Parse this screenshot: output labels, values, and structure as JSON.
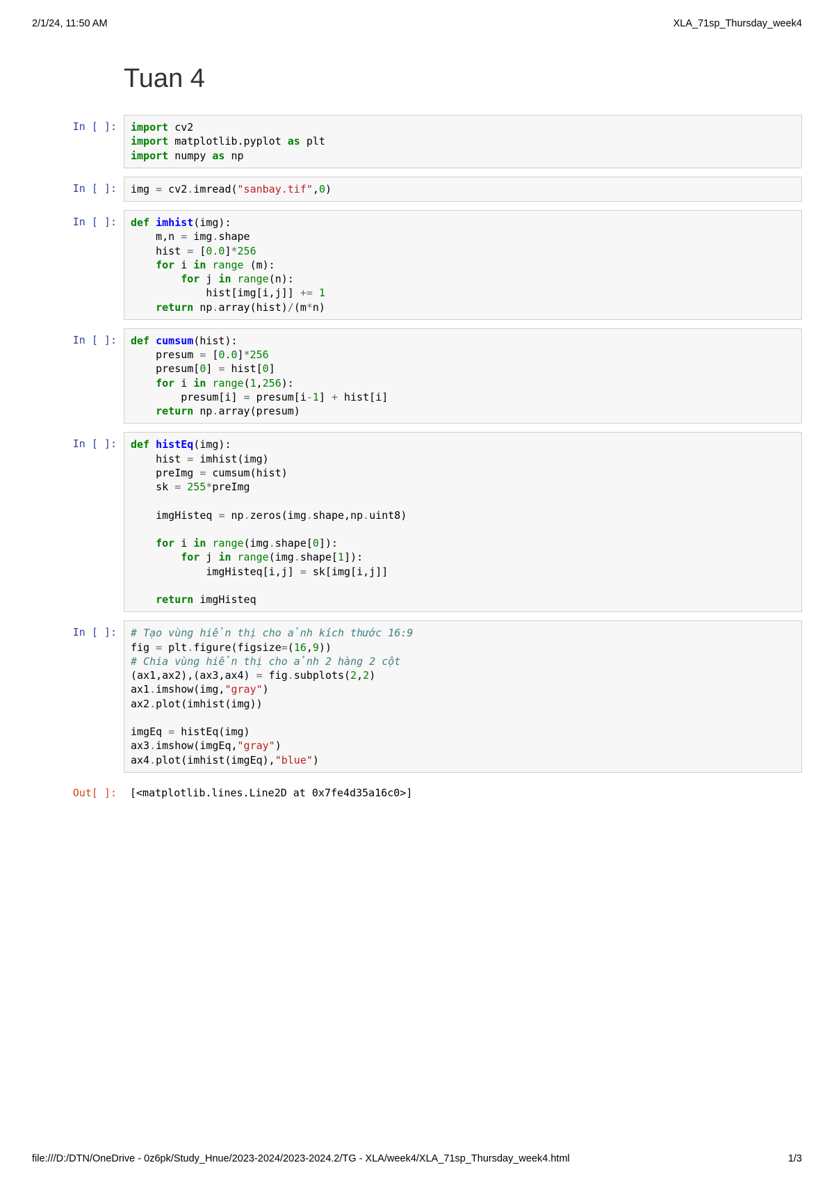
{
  "header": {
    "left": "2/1/24, 11:50 AM",
    "right": "XLA_71sp_Thursday_week4"
  },
  "footer": {
    "left": "file:///D:/DTN/OneDrive - 0z6pk/Study_Hnue/2023-2024/2023-2024.2/TG - XLA/week4/XLA_71sp_Thursday_week4.html",
    "right": "1/3"
  },
  "title": "Tuan 4",
  "prompts": {
    "in": "In [ ]:",
    "out": "Out[ ]:"
  },
  "cells": [
    {
      "type": "code",
      "tokens": [
        [
          {
            "c": "kw",
            "t": "import"
          },
          {
            "t": " cv2"
          }
        ],
        [
          {
            "c": "kw",
            "t": "import"
          },
          {
            "t": " matplotlib.pyplot "
          },
          {
            "c": "kw",
            "t": "as"
          },
          {
            "t": " plt"
          }
        ],
        [
          {
            "c": "kw",
            "t": "import"
          },
          {
            "t": " numpy "
          },
          {
            "c": "kw",
            "t": "as"
          },
          {
            "t": " np"
          }
        ]
      ]
    },
    {
      "type": "code",
      "tokens": [
        [
          {
            "t": "img "
          },
          {
            "c": "op",
            "t": "="
          },
          {
            "t": " cv2"
          },
          {
            "c": "op",
            "t": "."
          },
          {
            "t": "imread("
          },
          {
            "c": "str",
            "t": "\"sanbay.tif\""
          },
          {
            "t": ","
          },
          {
            "c": "num",
            "t": "0"
          },
          {
            "t": ")"
          }
        ]
      ]
    },
    {
      "type": "code",
      "tokens": [
        [
          {
            "c": "kw",
            "t": "def"
          },
          {
            "t": " "
          },
          {
            "c": "nn",
            "t": "imhist"
          },
          {
            "t": "(img):"
          }
        ],
        [
          {
            "t": "    m,n "
          },
          {
            "c": "op",
            "t": "="
          },
          {
            "t": " img"
          },
          {
            "c": "op",
            "t": "."
          },
          {
            "t": "shape"
          }
        ],
        [
          {
            "t": "    hist "
          },
          {
            "c": "op",
            "t": "="
          },
          {
            "t": " ["
          },
          {
            "c": "num",
            "t": "0.0"
          },
          {
            "t": "]"
          },
          {
            "c": "op",
            "t": "*"
          },
          {
            "c": "num",
            "t": "256"
          }
        ],
        [
          {
            "t": "    "
          },
          {
            "c": "kw",
            "t": "for"
          },
          {
            "t": " i "
          },
          {
            "c": "kw",
            "t": "in"
          },
          {
            "t": " "
          },
          {
            "c": "bi",
            "t": "range"
          },
          {
            "t": " (m):"
          }
        ],
        [
          {
            "t": "        "
          },
          {
            "c": "kw",
            "t": "for"
          },
          {
            "t": " j "
          },
          {
            "c": "kw",
            "t": "in"
          },
          {
            "t": " "
          },
          {
            "c": "bi",
            "t": "range"
          },
          {
            "t": "(n):"
          }
        ],
        [
          {
            "t": "            hist[img[i,j]] "
          },
          {
            "c": "op",
            "t": "+="
          },
          {
            "t": " "
          },
          {
            "c": "num",
            "t": "1"
          }
        ],
        [
          {
            "t": "    "
          },
          {
            "c": "kw",
            "t": "return"
          },
          {
            "t": " np"
          },
          {
            "c": "op",
            "t": "."
          },
          {
            "t": "array(hist)"
          },
          {
            "c": "op",
            "t": "/"
          },
          {
            "t": "(m"
          },
          {
            "c": "op",
            "t": "*"
          },
          {
            "t": "n)"
          }
        ]
      ]
    },
    {
      "type": "code",
      "tokens": [
        [
          {
            "c": "kw",
            "t": "def"
          },
          {
            "t": " "
          },
          {
            "c": "nn",
            "t": "cumsum"
          },
          {
            "t": "(hist):"
          }
        ],
        [
          {
            "t": "    presum "
          },
          {
            "c": "op",
            "t": "="
          },
          {
            "t": " ["
          },
          {
            "c": "num",
            "t": "0.0"
          },
          {
            "t": "]"
          },
          {
            "c": "op",
            "t": "*"
          },
          {
            "c": "num",
            "t": "256"
          }
        ],
        [
          {
            "t": "    presum["
          },
          {
            "c": "num",
            "t": "0"
          },
          {
            "t": "] "
          },
          {
            "c": "op",
            "t": "="
          },
          {
            "t": " hist["
          },
          {
            "c": "num",
            "t": "0"
          },
          {
            "t": "]"
          }
        ],
        [
          {
            "t": "    "
          },
          {
            "c": "kw",
            "t": "for"
          },
          {
            "t": " i "
          },
          {
            "c": "kw",
            "t": "in"
          },
          {
            "t": " "
          },
          {
            "c": "bi",
            "t": "range"
          },
          {
            "t": "("
          },
          {
            "c": "num",
            "t": "1"
          },
          {
            "t": ","
          },
          {
            "c": "num",
            "t": "256"
          },
          {
            "t": "):"
          }
        ],
        [
          {
            "t": "        presum[i] "
          },
          {
            "c": "op",
            "t": "="
          },
          {
            "t": " presum[i"
          },
          {
            "c": "op",
            "t": "-"
          },
          {
            "c": "num",
            "t": "1"
          },
          {
            "t": "] "
          },
          {
            "c": "op",
            "t": "+"
          },
          {
            "t": " hist[i]"
          }
        ],
        [
          {
            "t": "    "
          },
          {
            "c": "kw",
            "t": "return"
          },
          {
            "t": " np"
          },
          {
            "c": "op",
            "t": "."
          },
          {
            "t": "array(presum)"
          }
        ]
      ]
    },
    {
      "type": "code",
      "tokens": [
        [
          {
            "c": "kw",
            "t": "def"
          },
          {
            "t": " "
          },
          {
            "c": "nn",
            "t": "histEq"
          },
          {
            "t": "(img):"
          }
        ],
        [
          {
            "t": "    hist "
          },
          {
            "c": "op",
            "t": "="
          },
          {
            "t": " imhist(img)"
          }
        ],
        [
          {
            "t": "    preImg "
          },
          {
            "c": "op",
            "t": "="
          },
          {
            "t": " cumsum(hist)"
          }
        ],
        [
          {
            "t": "    sk "
          },
          {
            "c": "op",
            "t": "="
          },
          {
            "t": " "
          },
          {
            "c": "num",
            "t": "255"
          },
          {
            "c": "op",
            "t": "*"
          },
          {
            "t": "preImg"
          }
        ],
        [
          {
            "t": ""
          }
        ],
        [
          {
            "t": "    imgHisteq "
          },
          {
            "c": "op",
            "t": "="
          },
          {
            "t": " np"
          },
          {
            "c": "op",
            "t": "."
          },
          {
            "t": "zeros(img"
          },
          {
            "c": "op",
            "t": "."
          },
          {
            "t": "shape,np"
          },
          {
            "c": "op",
            "t": "."
          },
          {
            "t": "uint8)"
          }
        ],
        [
          {
            "t": ""
          }
        ],
        [
          {
            "t": "    "
          },
          {
            "c": "kw",
            "t": "for"
          },
          {
            "t": " i "
          },
          {
            "c": "kw",
            "t": "in"
          },
          {
            "t": " "
          },
          {
            "c": "bi",
            "t": "range"
          },
          {
            "t": "(img"
          },
          {
            "c": "op",
            "t": "."
          },
          {
            "t": "shape["
          },
          {
            "c": "num",
            "t": "0"
          },
          {
            "t": "]):"
          }
        ],
        [
          {
            "t": "        "
          },
          {
            "c": "kw",
            "t": "for"
          },
          {
            "t": " j "
          },
          {
            "c": "kw",
            "t": "in"
          },
          {
            "t": " "
          },
          {
            "c": "bi",
            "t": "range"
          },
          {
            "t": "(img"
          },
          {
            "c": "op",
            "t": "."
          },
          {
            "t": "shape["
          },
          {
            "c": "num",
            "t": "1"
          },
          {
            "t": "]):"
          }
        ],
        [
          {
            "t": "            imgHisteq[i,j] "
          },
          {
            "c": "op",
            "t": "="
          },
          {
            "t": " sk[img[i,j]]"
          }
        ],
        [
          {
            "t": ""
          }
        ],
        [
          {
            "t": "    "
          },
          {
            "c": "kw",
            "t": "return"
          },
          {
            "t": " imgHisteq"
          }
        ]
      ]
    },
    {
      "type": "code",
      "tokens": [
        [
          {
            "c": "cm",
            "t": "# Tạo vùng hiển thị cho ảnh kích thước 16:9"
          }
        ],
        [
          {
            "t": "fig "
          },
          {
            "c": "op",
            "t": "="
          },
          {
            "t": " plt"
          },
          {
            "c": "op",
            "t": "."
          },
          {
            "t": "figure(figsize"
          },
          {
            "c": "op",
            "t": "="
          },
          {
            "t": "("
          },
          {
            "c": "num",
            "t": "16"
          },
          {
            "t": ","
          },
          {
            "c": "num",
            "t": "9"
          },
          {
            "t": "))"
          }
        ],
        [
          {
            "c": "cm",
            "t": "# Chia vùng hiển thị cho ảnh 2 hàng 2 cột"
          }
        ],
        [
          {
            "t": "(ax1,ax2),(ax3,ax4) "
          },
          {
            "c": "op",
            "t": "="
          },
          {
            "t": " fig"
          },
          {
            "c": "op",
            "t": "."
          },
          {
            "t": "subplots("
          },
          {
            "c": "num",
            "t": "2"
          },
          {
            "t": ","
          },
          {
            "c": "num",
            "t": "2"
          },
          {
            "t": ")"
          }
        ],
        [
          {
            "t": "ax1"
          },
          {
            "c": "op",
            "t": "."
          },
          {
            "t": "imshow(img,"
          },
          {
            "c": "str",
            "t": "\"gray\""
          },
          {
            "t": ")"
          }
        ],
        [
          {
            "t": "ax2"
          },
          {
            "c": "op",
            "t": "."
          },
          {
            "t": "plot(imhist(img))"
          }
        ],
        [
          {
            "t": ""
          }
        ],
        [
          {
            "t": "imgEq "
          },
          {
            "c": "op",
            "t": "="
          },
          {
            "t": " histEq(img)"
          }
        ],
        [
          {
            "t": "ax3"
          },
          {
            "c": "op",
            "t": "."
          },
          {
            "t": "imshow(imgEq,"
          },
          {
            "c": "str",
            "t": "\"gray\""
          },
          {
            "t": ")"
          }
        ],
        [
          {
            "t": "ax4"
          },
          {
            "c": "op",
            "t": "."
          },
          {
            "t": "plot(imhist(imgEq),"
          },
          {
            "c": "str",
            "t": "\"blue\""
          },
          {
            "t": ")"
          }
        ]
      ]
    },
    {
      "type": "output",
      "text": "[<matplotlib.lines.Line2D at 0x7fe4d35a16c0>]"
    }
  ]
}
